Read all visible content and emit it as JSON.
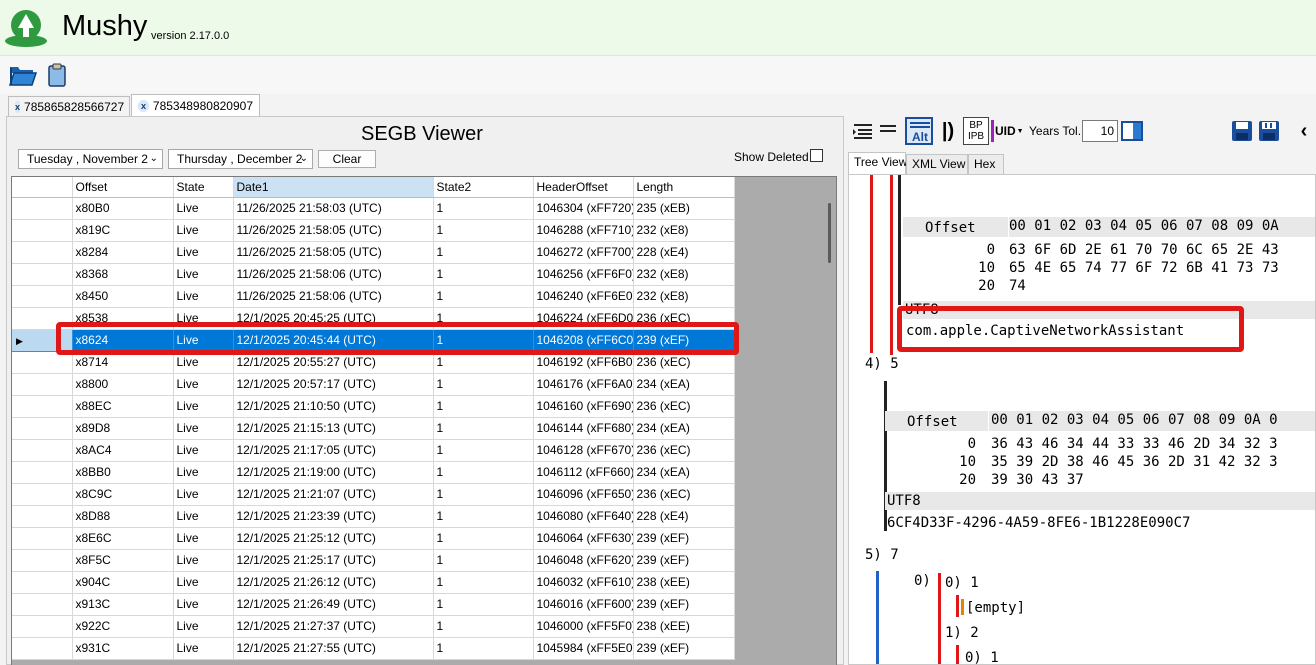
{
  "app": {
    "name": "Mushy",
    "version": "version 2.17.0.0"
  },
  "doc_tabs": [
    {
      "close": "x",
      "label": "785865828566727"
    },
    {
      "close": "x",
      "label": "785348980820907"
    }
  ],
  "viewer": {
    "title": "SEGB Viewer",
    "start_date": "Tuesday   , November 2",
    "end_date": "Thursday   , December 2",
    "clear_label": "Clear",
    "show_deleted_label": "Show Deleted",
    "columns": [
      "Offset",
      "State",
      "Date1",
      "State2",
      "HeaderOffset",
      "Length"
    ],
    "rows": [
      [
        "x80B0",
        "Live",
        "11/26/2025 21:58:03 (UTC)",
        "1",
        "1046304 (xFF720)",
        "235 (xEB)"
      ],
      [
        "x819C",
        "Live",
        "11/26/2025 21:58:05 (UTC)",
        "1",
        "1046288 (xFF710)",
        "232 (xE8)"
      ],
      [
        "x8284",
        "Live",
        "11/26/2025 21:58:05 (UTC)",
        "1",
        "1046272 (xFF700)",
        "228 (xE4)"
      ],
      [
        "x8368",
        "Live",
        "11/26/2025 21:58:06 (UTC)",
        "1",
        "1046256 (xFF6F0)",
        "232 (xE8)"
      ],
      [
        "x8450",
        "Live",
        "11/26/2025 21:58:06 (UTC)",
        "1",
        "1046240 (xFF6E0)",
        "232 (xE8)"
      ],
      [
        "x8538",
        "Live",
        "12/1/2025 20:45:25 (UTC)",
        "1",
        "1046224 (xFF6D0)",
        "236 (xEC)"
      ],
      [
        "x8624",
        "Live",
        "12/1/2025 20:45:44 (UTC)",
        "1",
        "1046208 (xFF6C0)",
        "239 (xEF)"
      ],
      [
        "x8714",
        "Live",
        "12/1/2025 20:55:27 (UTC)",
        "1",
        "1046192 (xFF6B0)",
        "236 (xEC)"
      ],
      [
        "x8800",
        "Live",
        "12/1/2025 20:57:17 (UTC)",
        "1",
        "1046176 (xFF6A0)",
        "234 (xEA)"
      ],
      [
        "x88EC",
        "Live",
        "12/1/2025 21:10:50 (UTC)",
        "1",
        "1046160 (xFF690)",
        "236 (xEC)"
      ],
      [
        "x89D8",
        "Live",
        "12/1/2025 21:15:13 (UTC)",
        "1",
        "1046144 (xFF680)",
        "234 (xEA)"
      ],
      [
        "x8AC4",
        "Live",
        "12/1/2025 21:17:05 (UTC)",
        "1",
        "1046128 (xFF670)",
        "236 (xEC)"
      ],
      [
        "x8BB0",
        "Live",
        "12/1/2025 21:19:00 (UTC)",
        "1",
        "1046112 (xFF660)",
        "234 (xEA)"
      ],
      [
        "x8C9C",
        "Live",
        "12/1/2025 21:21:07 (UTC)",
        "1",
        "1046096 (xFF650)",
        "236 (xEC)"
      ],
      [
        "x8D88",
        "Live",
        "12/1/2025 21:23:39 (UTC)",
        "1",
        "1046080 (xFF640)",
        "228 (xE4)"
      ],
      [
        "x8E6C",
        "Live",
        "12/1/2025 21:25:12 (UTC)",
        "1",
        "1046064 (xFF630)",
        "239 (xEF)"
      ],
      [
        "x8F5C",
        "Live",
        "12/1/2025 21:25:17 (UTC)",
        "1",
        "1046048 (xFF620)",
        "239 (xEF)"
      ],
      [
        "x904C",
        "Live",
        "12/1/2025 21:26:12 (UTC)",
        "1",
        "1046032 (xFF610)",
        "238 (xEE)"
      ],
      [
        "x913C",
        "Live",
        "12/1/2025 21:26:49 (UTC)",
        "1",
        "1046016 (xFF600)",
        "239 (xEF)"
      ],
      [
        "x922C",
        "Live",
        "12/1/2025 21:27:37 (UTC)",
        "1",
        "1046000 (xFF5F0)",
        "238 (xEE)"
      ],
      [
        "x931C",
        "Live",
        "12/1/2025 21:27:55 (UTC)",
        "1",
        "1045984 (xFF5E0)",
        "239 (xEF)"
      ]
    ],
    "selected_row": 6
  },
  "right_toolbar": {
    "uid_label": "UID",
    "years_tol_label": "Years Tol.",
    "years_tol_value": "10",
    "bp_label_top": "BP",
    "bp_label_bottom": "IPB",
    "alt_label": "Alt"
  },
  "view_tabs": [
    "Tree View",
    "XML View",
    "Hex"
  ],
  "tree": {
    "hex1": {
      "header_offset": "Offset",
      "header_bytes": "00 01 02 03 04 05 06 07 08 09 0A",
      "rows": [
        {
          "off": "0",
          "bytes": "63 6F 6D 2E 61 70 70 6C 65 2E 43"
        },
        {
          "off": "10",
          "bytes": "65 4E 65 74 77 6F 72 6B 41 73 73"
        },
        {
          "off": "20",
          "bytes": "74"
        }
      ],
      "enc_label": "UTF8",
      "text": "com.apple.CaptiveNetworkAssistant"
    },
    "node4": "4)  5",
    "hex2": {
      "header_offset": "Offset",
      "header_bytes": "00 01 02 03 04 05 06 07 08 09 0A 0",
      "rows": [
        {
          "off": "0",
          "bytes": "36 43 46 34 44 33 33 46 2D 34 32 3"
        },
        {
          "off": "10",
          "bytes": "35 39 2D 38 46 45 36 2D 31 42 32 3"
        },
        {
          "off": "20",
          "bytes": "39 30 43 37"
        }
      ],
      "enc_label": "UTF8",
      "text": "6CF4D33F-4296-4A59-8FE6-1B1228E090C7"
    },
    "node5": "5)  7",
    "sub0": "0)",
    "sub00": "0)  1",
    "empty": "[empty]",
    "sub1": "1)  2",
    "sub10": "0)  1"
  }
}
